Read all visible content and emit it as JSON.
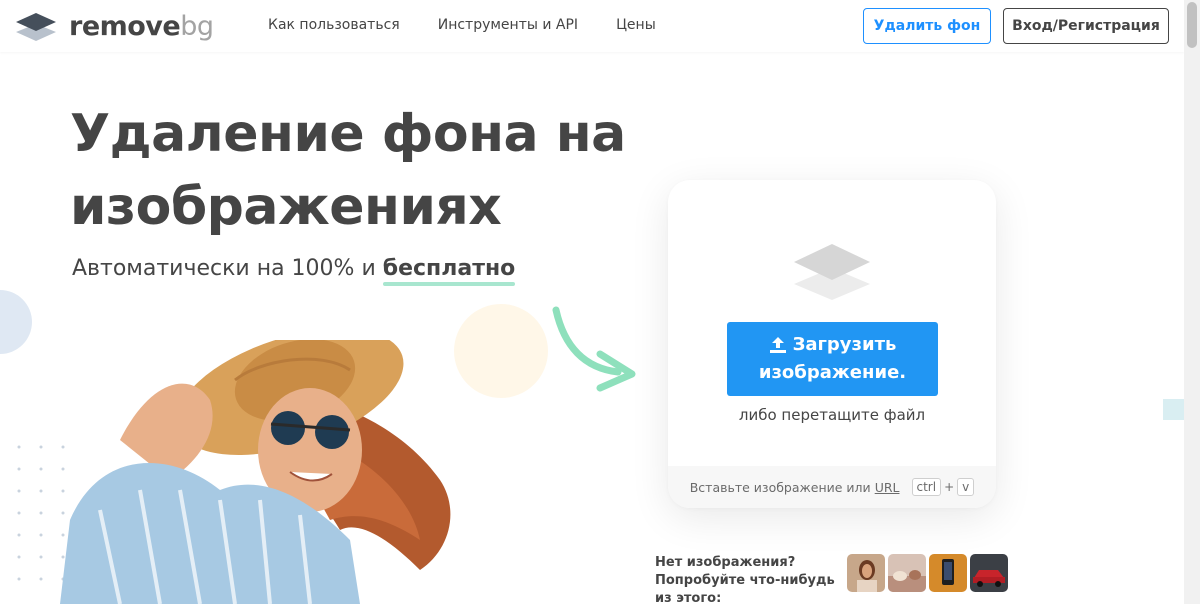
{
  "header": {
    "logo_main": "remove",
    "logo_accent": "bg",
    "nav": [
      "Как пользоваться",
      "Инструменты и API",
      "Цены"
    ],
    "remove_button": "Удалить фон",
    "login_button": "Вход/Регистрация"
  },
  "hero": {
    "title": "Удаление фона на изображениях",
    "subtitle_prefix": "Автоматически на 100% и ",
    "subtitle_highlight": "бесплатно"
  },
  "upload": {
    "button_line1": "Загрузить",
    "button_line2": "изображение.",
    "drag_text": "либо перетащите файл",
    "paste_text": "Вставьте изображение или",
    "url_link": "URL",
    "key_ctrl": "ctrl",
    "key_plus": "+",
    "key_v": "v"
  },
  "samples": {
    "text": "Нет изображения? Попробуйте что-нибудь из этого:",
    "thumbnails": [
      "woman-portrait",
      "animals-on-couch",
      "phone-product",
      "red-car"
    ]
  },
  "colors": {
    "primary_blue": "#2196f3",
    "text_dark": "#454545",
    "highlight_green": "#a8e6cf"
  }
}
